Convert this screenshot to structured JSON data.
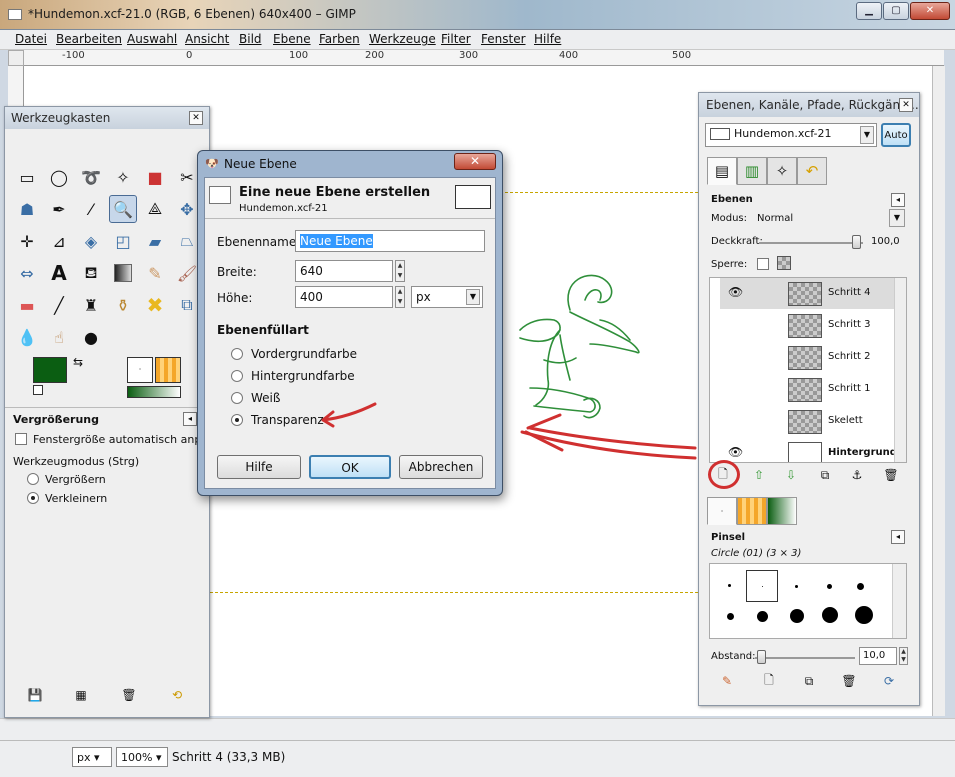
{
  "window": {
    "title": "*Hundemon.xcf-21.0 (RGB, 6 Ebenen) 640x400 – GIMP",
    "minimize": "▁",
    "maximize": "▢",
    "close": "✕"
  },
  "menu": [
    "Datei",
    "Bearbeiten",
    "Auswahl",
    "Ansicht",
    "Bild",
    "Ebene",
    "Farben",
    "Werkzeuge",
    "Filter",
    "Fenster",
    "Hilfe"
  ],
  "ruler": {
    "labels": [
      "-100",
      "0",
      "100",
      "200",
      "300",
      "400",
      "500"
    ]
  },
  "toolbox": {
    "title": "Werkzeugkasten",
    "tools": [
      "rect-select",
      "ellipse-select",
      "free-select",
      "fuzzy-select",
      "color-select",
      "scissors",
      "foreground-select",
      "paths",
      "color-picker",
      "zoom",
      "measure",
      "move",
      "align",
      "crop",
      "rotate",
      "scale",
      "shear",
      "perspective",
      "flip",
      "text",
      "bucket-fill",
      "blend",
      "pencil",
      "paintbrush",
      "eraser",
      "airbrush",
      "ink",
      "clone",
      "heal",
      "perspective-clone",
      "blur",
      "smudge",
      "dodge-burn"
    ],
    "fg_color": "#0b5e12",
    "bg_color": "#ffffff",
    "options_title": "Vergrößerung",
    "auto_resize_label": "Fenstergröße automatisch anpassen",
    "mode_label": "Werkzeugmodus  (Strg)",
    "mode_options": [
      "Vergrößern",
      "Verkleinern"
    ],
    "mode_selected": "Verkleinern"
  },
  "dialog": {
    "title": "Neue Ebene",
    "heading": "Eine neue Ebene erstellen",
    "subheading": "Hundemon.xcf-21",
    "name_label": "Ebenenname:",
    "name_value": "Neue Ebene",
    "width_label": "Breite:",
    "width_value": "640",
    "height_label": "Höhe:",
    "height_value": "400",
    "unit": "px",
    "fill_title": "Ebenenfüllart",
    "fill_options": [
      "Vordergrundfarbe",
      "Hintergrundfarbe",
      "Weiß",
      "Transparenz"
    ],
    "fill_selected": "Transparenz",
    "btn_help": "Hilfe",
    "btn_ok": "OK",
    "btn_cancel": "Abbrechen"
  },
  "dock": {
    "title": "Ebenen, Kanäle, Pfade, Rückgängi...",
    "image_select": "Hundemon.xcf-21",
    "auto_button": "Auto",
    "layers_title": "Ebenen",
    "mode_label": "Modus:",
    "mode_value": "Normal",
    "opacity_label": "Deckkraft:",
    "opacity_value": "100,0",
    "lock_label": "Sperre:",
    "layers": [
      {
        "name": "Schritt 4",
        "visible": true,
        "selected": true,
        "bold": false
      },
      {
        "name": "Schritt 3",
        "visible": false,
        "selected": false,
        "bold": false
      },
      {
        "name": "Schritt 2",
        "visible": false,
        "selected": false,
        "bold": false
      },
      {
        "name": "Schritt 1",
        "visible": false,
        "selected": false,
        "bold": false
      },
      {
        "name": "Skelett",
        "visible": false,
        "selected": false,
        "bold": false
      },
      {
        "name": "Hintergrund",
        "visible": true,
        "selected": false,
        "bold": true
      }
    ],
    "brushes_title": "Pinsel",
    "brush_name": "Circle (01) (3 × 3)",
    "spacing_label": "Abstand:",
    "spacing_value": "10,0"
  },
  "status": {
    "unit": "px",
    "zoom": "100%",
    "info": "Schritt 4 (33,3 MB)"
  },
  "accent": "#3c7fb1",
  "annotation_color": "#d03030"
}
